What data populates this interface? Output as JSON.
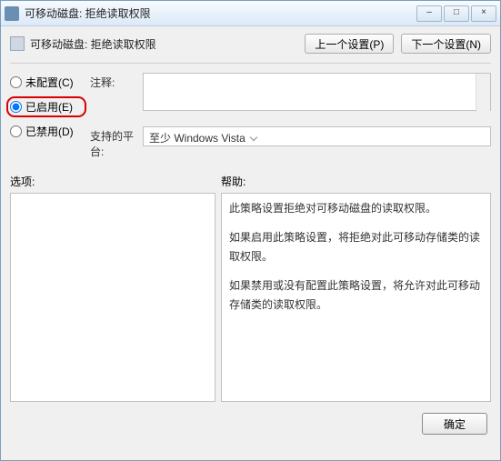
{
  "window": {
    "title": "可移动磁盘: 拒绝读取权限",
    "minimize": "–",
    "maximize": "□",
    "close": "×"
  },
  "header": {
    "title": "可移动磁盘: 拒绝读取权限",
    "prev_btn": "上一个设置(P)",
    "next_btn": "下一个设置(N)"
  },
  "radios": {
    "not_configured": "未配置(C)",
    "enabled": "已启用(E)",
    "disabled": "已禁用(D)"
  },
  "fields": {
    "comment_label": "注释:",
    "comment_value": "",
    "platform_label": "支持的平台:",
    "platform_value": "至少 Windows Vista"
  },
  "sections": {
    "options_label": "选项:",
    "help_label": "帮助:"
  },
  "help": {
    "p1": "此策略设置拒绝对可移动磁盘的读取权限。",
    "p2": "如果启用此策略设置，将拒绝对此可移动存储类的读取权限。",
    "p3": "如果禁用或没有配置此策略设置，将允许对此可移动存储类的读取权限。"
  },
  "buttons": {
    "ok": "确定"
  }
}
